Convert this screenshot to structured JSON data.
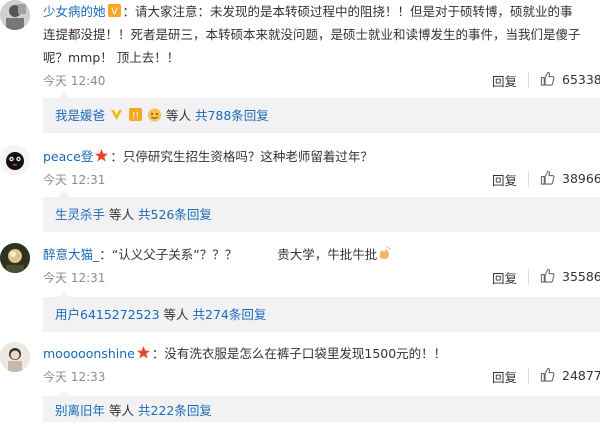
{
  "comments": [
    {
      "username": "少女病的她",
      "text1": "：请大家注意：未发现的是本转硕过程中的阻挠！！但是对于硕转博，硕就业的事",
      "text2": "连提都没提！！死者是研三，本转硕本来就没问题，是硕士就业和读博发生的事件，当我们是傻子",
      "text3": "呢？mmp！ 顶上去！！",
      "time": "今天 12:40",
      "reply_label": "回复",
      "likes": "65338",
      "reply_summary": {
        "user": "我是媛爸",
        "suffix": "等人",
        "count_link": "共788条回复"
      }
    },
    {
      "username": "peace登",
      "text1": "：只停研究生招生资格吗？这种老师留着过年？",
      "time": "今天 12:31",
      "reply_label": "回复",
      "likes": "38966",
      "reply_summary": {
        "user": "生灵杀手",
        "suffix": "等人",
        "count_link": "共526条回复"
      }
    },
    {
      "username": "醉意大猫_",
      "text1": "：“认义父子关系”？？？",
      "text1b": "贵大学，牛批牛批",
      "time": "今天 12:31",
      "reply_label": "回复",
      "likes": "35586",
      "reply_summary": {
        "user": "用户6415272523",
        "suffix": "等人",
        "count_link": "共274条回复"
      }
    },
    {
      "username": "mooooonshine",
      "text1": "：没有洗衣服是怎么在裤子口袋里发现1500元的！！",
      "time": "今天 12:33",
      "reply_label": "回复",
      "likes": "24877",
      "reply_summary": {
        "user": "别离旧年",
        "suffix": "等人",
        "count_link": "共222条回复"
      }
    }
  ],
  "colors": {
    "link": "#1b6ab5",
    "reply_bg": "#f2f2f5",
    "time": "#8c8c8c"
  },
  "icons": [
    "avatar",
    "vip-badge-icon",
    "star-badge-icon",
    "thumbs-up-icon",
    "heart-emoji-icon",
    "clap-emoji-icon"
  ]
}
